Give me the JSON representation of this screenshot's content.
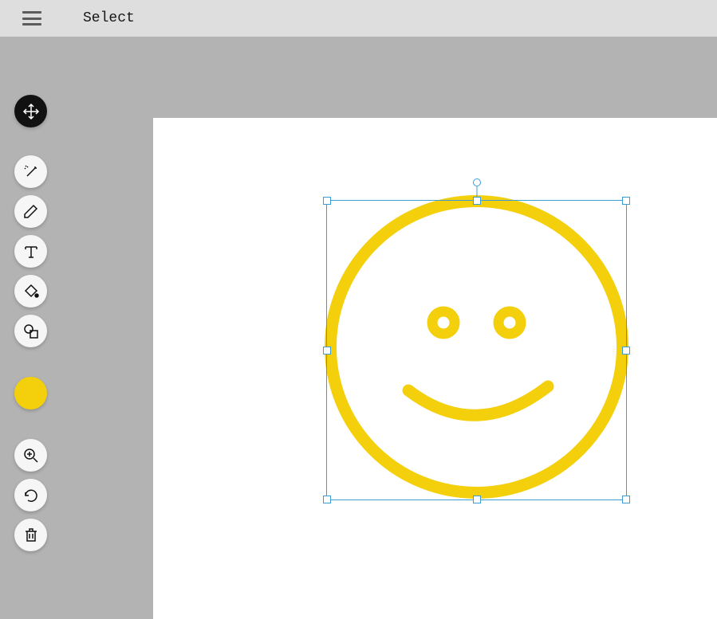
{
  "header": {
    "tool_name": "Select"
  },
  "tools": {
    "select": {
      "active": true
    },
    "magic_wand": {
      "active": false
    },
    "pen": {
      "active": false
    },
    "text": {
      "active": false
    },
    "fill": {
      "active": false
    },
    "shapes": {
      "active": false
    },
    "zoom": {
      "active": false
    },
    "undo": {
      "active": false
    },
    "delete": {
      "active": false
    }
  },
  "color": {
    "current": "#f4cf0c"
  },
  "shape": {
    "type": "smiley",
    "stroke_color": "#f4cf0c",
    "selected": true
  }
}
